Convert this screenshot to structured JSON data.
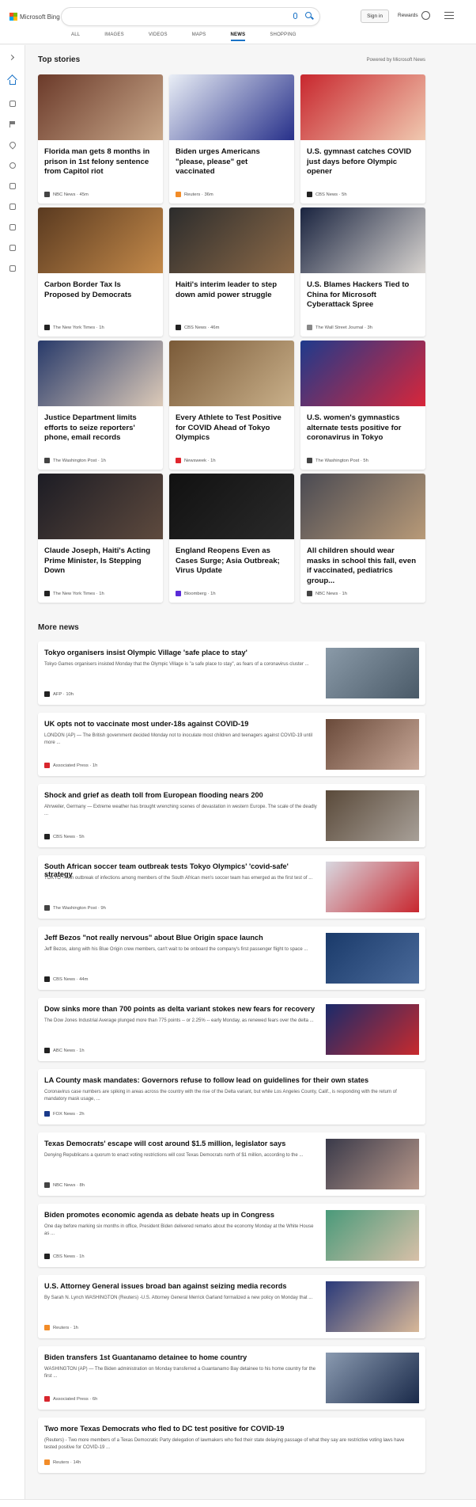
{
  "header": {
    "logo_text": "Microsoft Bing",
    "search_value": "",
    "signin_label": "Sign in",
    "rewards_label": "Rewards",
    "tabs": [
      "ALL",
      "IMAGES",
      "VIDEOS",
      "MAPS",
      "NEWS",
      "SHOPPING"
    ],
    "active_tab": "NEWS"
  },
  "top_stories": {
    "heading": "Top stories",
    "powered_by": "Powered by Microsoft News",
    "cards": [
      {
        "title": "Florida man gets 8 months in prison in 1st felony sentence from Capitol riot",
        "source": "NBC News · 45m",
        "src_color": "#444",
        "img_a": "#6b3a2a",
        "img_b": "#c9a88a"
      },
      {
        "title": "Biden urges Americans \"please, please\" get vaccinated",
        "source": "Reuters · 36m",
        "src_color": "#f28c28",
        "img_a": "#e9eef6",
        "img_b": "#27308a"
      },
      {
        "title": "U.S. gymnast catches COVID just days before Olympic opener",
        "source": "CBS News · 5h",
        "src_color": "#222",
        "img_a": "#c8272e",
        "img_b": "#f0c9b0"
      },
      {
        "title": "Carbon Border Tax Is Proposed by Democrats",
        "source": "The New York Times · 1h",
        "src_color": "#222",
        "img_a": "#5a3a20",
        "img_b": "#c48a4a"
      },
      {
        "title": "Haiti's interim leader to step down amid power struggle",
        "source": "CBS News · 46m",
        "src_color": "#222",
        "img_a": "#2c2c2c",
        "img_b": "#8c6a48"
      },
      {
        "title": "U.S. Blames Hackers Tied to China for Microsoft Cyberattack Spree",
        "source": "The Wall Street Journal · 3h",
        "src_color": "#888",
        "img_a": "#1a2440",
        "img_b": "#d8d4d0"
      },
      {
        "title": "Justice Department limits efforts to seize reporters' phone, email records",
        "source": "The Washington Post · 1h",
        "src_color": "#444",
        "img_a": "#283a6a",
        "img_b": "#dccab8"
      },
      {
        "title": "Every Athlete to Test Positive for COVID Ahead of Tokyo Olympics",
        "source": "Newsweek · 1h",
        "src_color": "#e0262e",
        "img_a": "#7a5a38",
        "img_b": "#c9b08a"
      },
      {
        "title": "U.S. women's gymnastics alternate tests positive for coronavirus in Tokyo",
        "source": "The Washington Post · 5h",
        "src_color": "#444",
        "img_a": "#1e3a8c",
        "img_b": "#d8263a"
      },
      {
        "title": "Claude Joseph, Haiti's Acting Prime Minister, Is Stepping Down",
        "source": "The New York Times · 1h",
        "src_color": "#222",
        "img_a": "#1c1c24",
        "img_b": "#5e4a3e"
      },
      {
        "title": "England Reopens Even as Cases Surge; Asia Outbreak; Virus Update",
        "source": "Bloomberg · 1h",
        "src_color": "#5a2bd8",
        "img_a": "#111111",
        "img_b": "#2a2a2a"
      },
      {
        "title": "All children should wear masks in school this fall, even if vaccinated, pediatrics group...",
        "source": "NBC News · 1h",
        "src_color": "#444",
        "img_a": "#4a4a52",
        "img_b": "#b89a78"
      }
    ]
  },
  "more_news": {
    "heading": "More news",
    "items": [
      {
        "title": "Tokyo organisers insist Olympic Village 'safe place to stay'",
        "snippet": "Tokyo Games organisers insisted Monday that the Olympic Village is \"a safe place to stay\", as fears of a coronavirus cluster ...",
        "source": "AFP · 10h",
        "src_color": "#222",
        "img_a": "#8a9aa8",
        "img_b": "#4a5a68"
      },
      {
        "title": "UK opts not to vaccinate most under-18s against COVID-19",
        "snippet": "LONDON (AP) — The British government decided Monday not to inoculate most children and teenagers against COVID-19 until more ...",
        "source": "Associated Press · 1h",
        "src_color": "#d8262e",
        "img_a": "#6a4a3a",
        "img_b": "#c8a898"
      },
      {
        "title": "Shock and grief as death toll from European flooding nears 200",
        "snippet": "Ahrweiler, Germany — Extreme weather has brought wrenching scenes of devastation in western Europe. The scale of the deadly ...",
        "source": "CBS News · 5h",
        "src_color": "#222",
        "img_a": "#5a4a3a",
        "img_b": "#a8a098"
      },
      {
        "title": "South African soccer team outbreak tests Tokyo Olympics' 'covid-safe' strategy",
        "snippet": "TOKYO — An outbreak of infections among members of the South African men's soccer team has emerged as the first test of ...",
        "source": "The Washington Post · 9h",
        "src_color": "#444",
        "img_a": "#d8d8e0",
        "img_b": "#c8262e"
      },
      {
        "title": "Jeff Bezos \"not really nervous\" about Blue Origin space launch",
        "snippet": "Jeff Bezos, along with his Blue Origin crew members, can't wait to be onboard the company's first passenger flight to space ...",
        "source": "CBS News · 44m",
        "src_color": "#222",
        "img_a": "#1a3a6a",
        "img_b": "#4a6a9a"
      },
      {
        "title": "Dow sinks more than 700 points as delta variant stokes new fears for recovery",
        "snippet": "The Dow Jones Industrial Average plunged more than 775 points -- or 2.25% -- early Monday, as renewed fears over the delta ...",
        "source": "ABC News · 1h",
        "src_color": "#222",
        "img_a": "#1a2a6a",
        "img_b": "#c82a2e"
      },
      {
        "title": "LA County mask mandates: Governors refuse to follow lead on guidelines for their own states",
        "snippet": "Coronavirus case numbers are spiking in areas across the country with the rise of the Delta variant, but while Los Angeles County, Calif., is responding with the return of mandatory mask usage, ...",
        "source": "FOX News · 2h",
        "src_color": "#1a3a8a",
        "img_a": "",
        "img_b": ""
      },
      {
        "title": "Texas Democrats' escape will cost around $1.5 million, legislator says",
        "snippet": "Denying Republicans a quorum to enact voting restrictions will cost Texas Democrats north of $1 million, according to the ...",
        "source": "NBC News · 8h",
        "src_color": "#444",
        "img_a": "#3a3a4a",
        "img_b": "#b8988a"
      },
      {
        "title": "Biden promotes economic agenda as debate heats up in Congress",
        "snippet": "One day before marking six months in office, President Biden delivered remarks about the economy Monday at the White House as ...",
        "source": "CBS News · 1h",
        "src_color": "#222",
        "img_a": "#4a9a7a",
        "img_b": "#d8c0a8"
      },
      {
        "title": "U.S. Attorney General issues broad ban against seizing media records",
        "snippet": "By Sarah N. Lynch WASHINGTON (Reuters) -U.S. Attorney General Merrick Garland formalized a new policy on Monday that ...",
        "source": "Reuters · 1h",
        "src_color": "#f28c28",
        "img_a": "#2a3a7a",
        "img_b": "#d8b898"
      },
      {
        "title": "Biden transfers 1st Guantanamo detainee to home country",
        "snippet": "WASHINGTON (AP) — The Biden administration on Monday transferred a Guantanamo Bay detainee to his home country for the first ...",
        "source": "Associated Press · 6h",
        "src_color": "#d8262e",
        "img_a": "#8a9ab0",
        "img_b": "#1a2a4a"
      },
      {
        "title": "Two more Texas Democrats who fled to DC test positive for COVID-19",
        "snippet": "(Reuters) - Two more members of a Texas Democratic Party delegation of lawmakers who fled their state delaying passage of what they say are restrictive voting laws have tested positive for COVID-19 ...",
        "source": "Reuters · 14h",
        "src_color": "#f28c28",
        "img_a": "",
        "img_b": ""
      }
    ]
  }
}
